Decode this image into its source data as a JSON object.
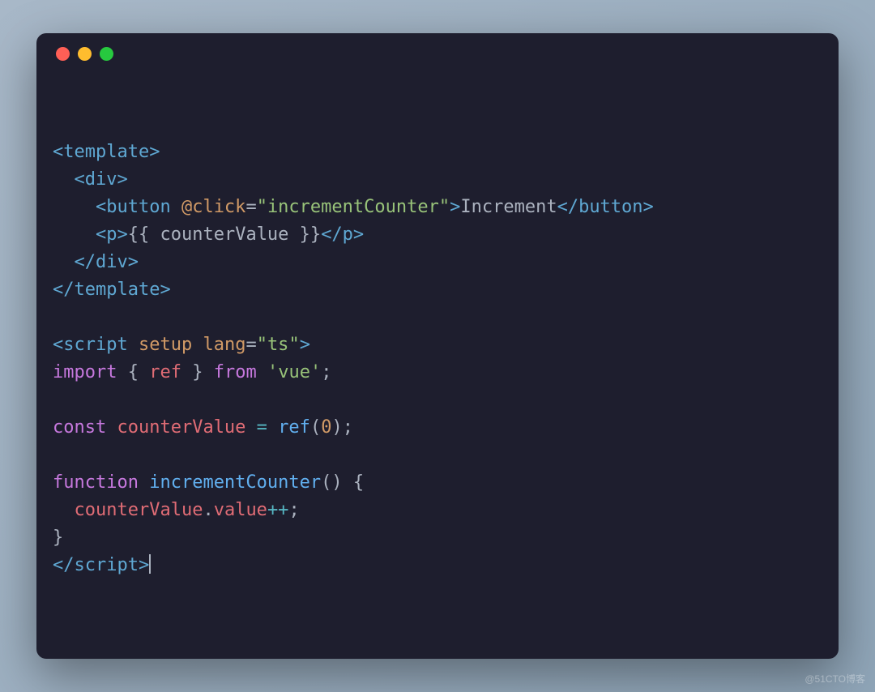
{
  "window": {
    "traffic_lights": [
      "red",
      "yellow",
      "green"
    ]
  },
  "code": {
    "line1": {
      "tag_open": "<template>"
    },
    "line2": {
      "indent": "  ",
      "tag_open": "<div>"
    },
    "line3": {
      "indent": "    ",
      "tag_open_start": "<button",
      "attr": "@click",
      "eq": "=",
      "q1": "\"",
      "val": "incrementCounter",
      "q2": "\"",
      "close_br": ">",
      "text": "Increment",
      "tag_close": "</button>"
    },
    "line4": {
      "indent": "    ",
      "tag_open": "<p>",
      "interp_open": "{{ ",
      "var": "counterValue",
      "interp_close": " }}",
      "tag_close": "</p>"
    },
    "line5": {
      "indent": "  ",
      "tag_close": "</div>"
    },
    "line6": {
      "tag_close": "</template>"
    },
    "line8": {
      "tag_open_start": "<script",
      "attr1": "setup",
      "attr2": "lang",
      "eq": "=",
      "q1": "\"",
      "val": "ts",
      "q2": "\"",
      "close_br": ">"
    },
    "line9": {
      "kw": "import",
      "punc1": " { ",
      "var": "ref",
      "punc2": " } ",
      "kw2": "from",
      "sp": " ",
      "q1": "'",
      "str": "vue",
      "q2": "'",
      "semi": ";"
    },
    "line11": {
      "kw": "const",
      "sp": " ",
      "var": "counterValue",
      "op": " = ",
      "fn": "ref",
      "paren1": "(",
      "num": "0",
      "paren2": ")",
      "semi": ";"
    },
    "line13": {
      "kw": "function",
      "sp": " ",
      "fn": "incrementCounter",
      "parens": "()",
      "brace": " {"
    },
    "line14": {
      "indent": "  ",
      "var": "counterValue",
      "dot": ".",
      "prop": "value",
      "op": "++",
      "semi": ";"
    },
    "line15": {
      "brace": "}"
    },
    "line16": {
      "tag_close_start": "</",
      "tag_name": "script",
      "close_br": ">"
    }
  },
  "watermark": "@51CTO博客"
}
